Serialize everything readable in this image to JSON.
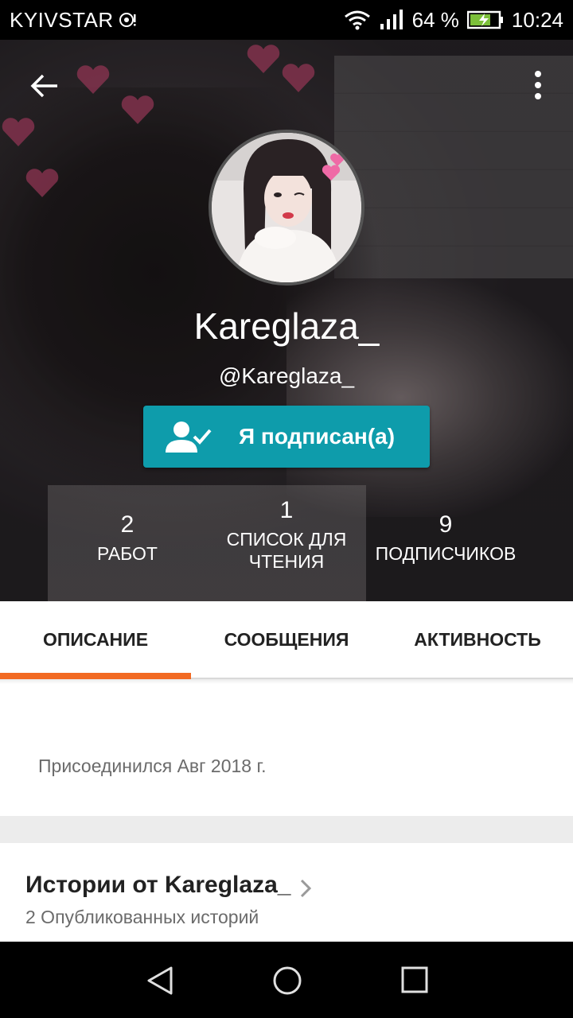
{
  "status_bar": {
    "carrier": "KYIVSTAR",
    "battery_percent": "64 %",
    "time": "10:24",
    "icons": [
      "sync-icon",
      "wifi-icon",
      "signal-icon",
      "battery-charging-icon"
    ]
  },
  "header": {
    "back_icon": "arrow-left-icon",
    "menu_icon": "more-vertical-icon",
    "avatar_icon": "avatar",
    "username": "Kareglaza_",
    "handle": "@Kareglaza_",
    "follow_button": {
      "label": "Я подписан(а)",
      "icon": "user-check-icon",
      "color": "#0e9cab"
    }
  },
  "stats": [
    {
      "value": "2",
      "label": "РАБОТ"
    },
    {
      "value": "1",
      "label_line1": "СПИСОК ДЛЯ",
      "label_line2": "ЧТЕНИЯ"
    },
    {
      "value": "9",
      "label": "ПОДПИСЧИКОВ"
    }
  ],
  "tabs": [
    {
      "label": "ОПИСАНИЕ",
      "active": true
    },
    {
      "label": "СООБЩЕНИЯ",
      "active": false
    },
    {
      "label": "АКТИВНОСТЬ",
      "active": false
    }
  ],
  "accent_color": "#f26a23",
  "about": {
    "joined": "Присоединился Авг 2018 г."
  },
  "stories": {
    "title": "Истории от Kareglaza_",
    "count_text": "2 Опубликованных историй",
    "chevron_icon": "chevron-right-icon"
  },
  "nav_bar": {
    "icons": [
      "nav-back-icon",
      "nav-home-icon",
      "nav-recent-icon"
    ]
  }
}
